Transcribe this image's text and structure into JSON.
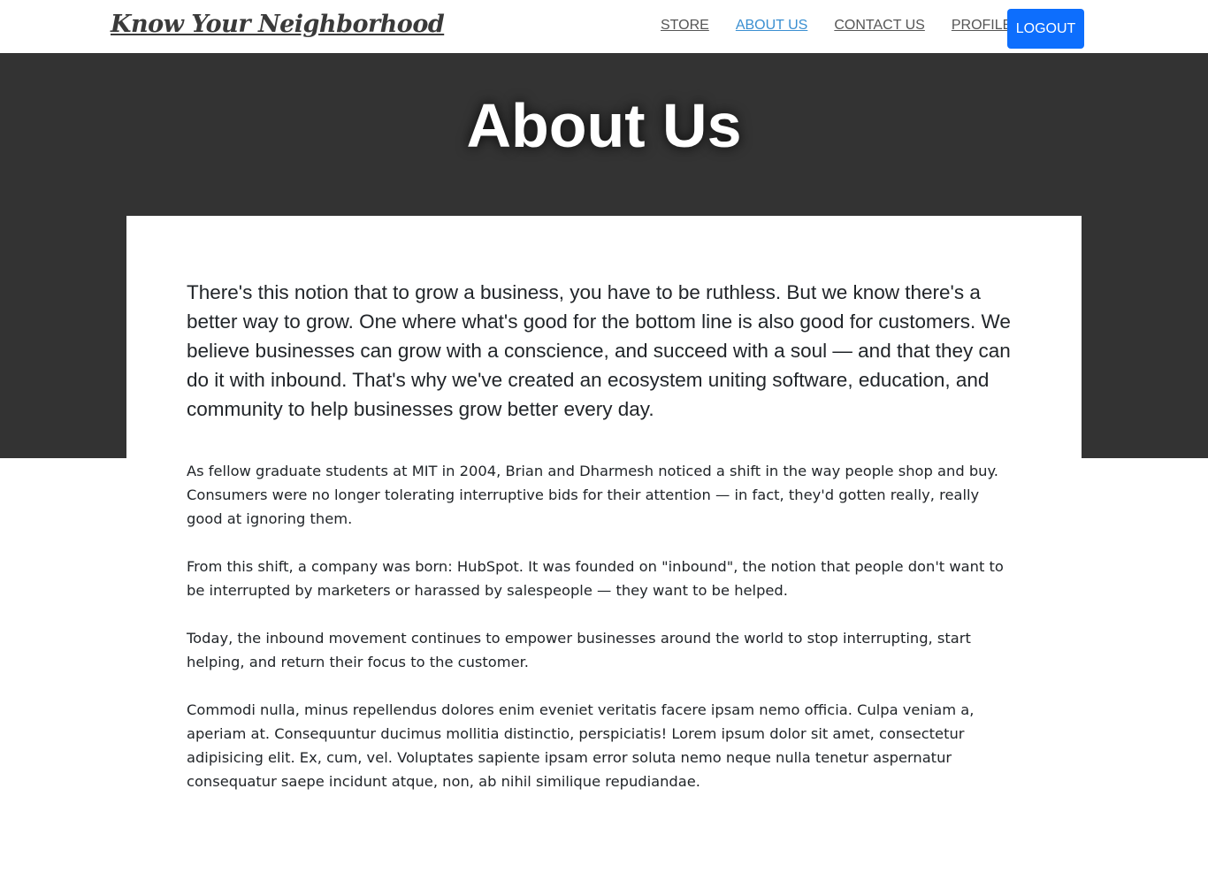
{
  "navbar": {
    "brand": "Know Your Neighborhood",
    "links": [
      {
        "label": "STORE"
      },
      {
        "label": "ABOUT US"
      },
      {
        "label": "CONTACT US"
      },
      {
        "label": "PROFILE"
      }
    ],
    "logout_label": "LOGOUT",
    "active_link": "ABOUT US",
    "colors": {
      "logout_bg": "#0d6efd",
      "active_link": "#3a8fd1",
      "hero_bg": "#333333"
    }
  },
  "hero": {
    "title": "About Us"
  },
  "content": {
    "lead": "There's this notion that to grow a business, you have to be ruthless. But we know there's a better way to grow. One where what's good for the bottom line is also good for customers. We believe businesses can grow with a conscience, and succeed with a soul — and that they can do it with inbound. That's why we've created an ecosystem uniting software, education, and community to help businesses grow better every day.",
    "paragraphs": [
      "As fellow graduate students at MIT in 2004, Brian and Dharmesh noticed a shift in the way people shop and buy. Consumers were no longer tolerating interruptive bids for their attention — in fact, they'd gotten really, really good at ignoring them.",
      "From this shift, a company was born: HubSpot. It was founded on \"inbound\", the notion that people don't want to be interrupted by marketers or harassed by salespeople — they want to be helped.",
      "Today, the inbound movement continues to empower businesses around the world to stop interrupting, start helping, and return their focus to the customer.",
      "Commodi nulla, minus repellendus dolores enim eveniet veritatis facere ipsam nemo officia. Culpa veniam a, aperiam at. Consequuntur ducimus mollitia distinctio, perspiciatis! Lorem ipsum dolor sit amet, consectetur adipisicing elit. Ex, cum, vel. Voluptates sapiente ipsam error soluta nemo neque nulla tenetur aspernatur consequatur saepe incidunt atque, non, ab nihil similique repudiandae."
    ]
  }
}
